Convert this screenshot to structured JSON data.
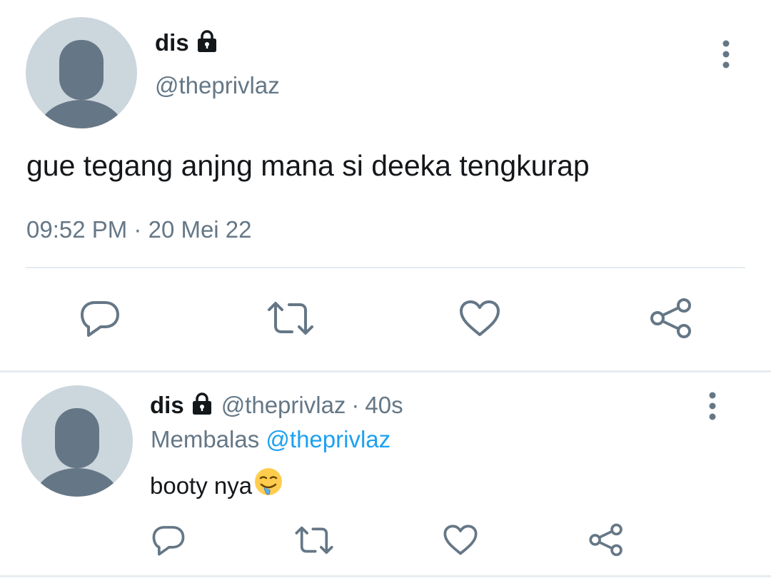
{
  "main_tweet": {
    "display_name": "dis",
    "handle": "@theprivlaz",
    "text": "gue tegang anjng mana si deeka tengkurap",
    "timestamp": "09:52 PM",
    "separator": "·",
    "date": "20 Mei 22"
  },
  "reply": {
    "display_name": "dis",
    "handle": "@theprivlaz",
    "separator": "·",
    "age": "40s",
    "replying_label": "Membalas",
    "replying_to": "@theprivlaz",
    "text": "booty nya"
  },
  "icons": {
    "lock": "lock-icon",
    "more": "more-vertical-icon",
    "reply": "reply-icon",
    "retweet": "retweet-icon",
    "like": "heart-icon",
    "share": "share-icon",
    "emoji": "drooling-face-emoji"
  },
  "colors": {
    "text_primary": "#14171a",
    "text_secondary": "#657786",
    "link": "#1da1f2",
    "icon": "#657786",
    "avatar_bg": "#ccd6dd",
    "avatar_fg": "#657786",
    "divider": "#e6ecf0"
  }
}
